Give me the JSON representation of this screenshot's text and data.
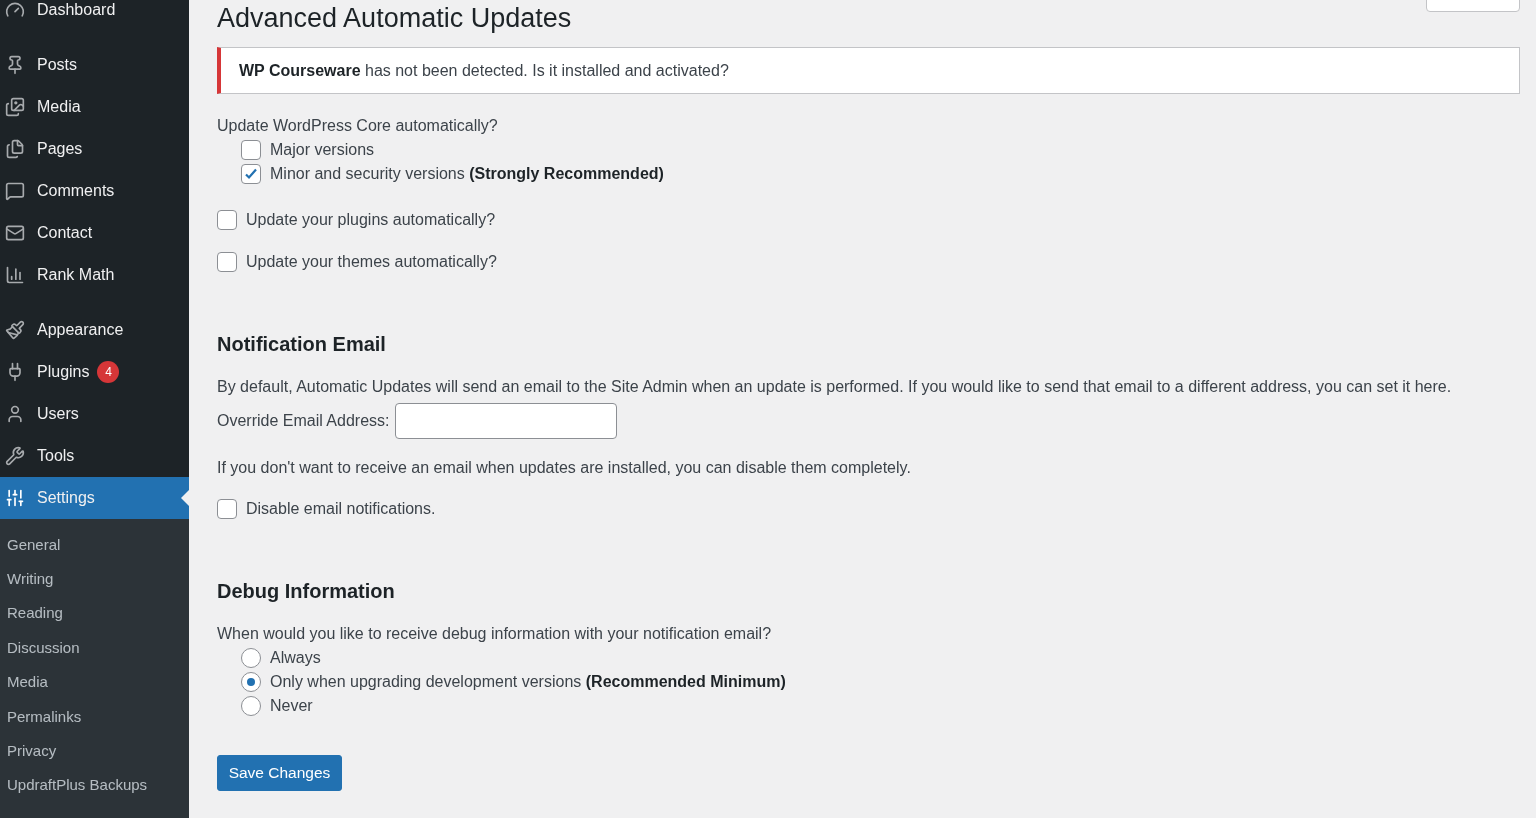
{
  "sidebar": {
    "menu_groups": [
      [
        {
          "label": "Dashboard",
          "selected": false
        }
      ],
      [
        {
          "label": "Posts",
          "selected": false
        },
        {
          "label": "Media",
          "selected": false
        },
        {
          "label": "Pages",
          "selected": false
        },
        {
          "label": "Comments",
          "selected": false
        },
        {
          "label": "Contact",
          "selected": false
        },
        {
          "label": "Rank Math",
          "selected": false
        }
      ],
      [
        {
          "label": "Appearance",
          "selected": false
        },
        {
          "label": "Plugins",
          "badge": "4",
          "selected": false
        },
        {
          "label": "Users",
          "selected": false
        },
        {
          "label": "Tools",
          "selected": false
        },
        {
          "label": "Settings",
          "selected": true
        }
      ]
    ],
    "submenu": [
      {
        "label": "General",
        "selected": false
      },
      {
        "label": "Writing",
        "selected": false
      },
      {
        "label": "Reading",
        "selected": false
      },
      {
        "label": "Discussion",
        "selected": false
      },
      {
        "label": "Media",
        "selected": false
      },
      {
        "label": "Permalinks",
        "selected": false
      },
      {
        "label": "Privacy",
        "selected": false
      },
      {
        "label": "UpdraftPlus Backups",
        "selected": false
      }
    ]
  },
  "page": {
    "title": "Advanced Automatic Updates",
    "notice": "**WP Courseware** has not been detected. Is it installed and activated?",
    "core": {
      "label": "Update WordPress Core automatically?",
      "options": [
        {
          "label": "Major versions",
          "checked": false
        },
        {
          "label": "Minor and security versions **(Strongly Recommended)**",
          "checked": true
        }
      ]
    },
    "checkboxes": [
      {
        "label": "Update your plugins automatically?",
        "checked": false
      },
      {
        "label": "Update your themes automatically?",
        "checked": false
      }
    ],
    "notification": {
      "heading": "Notification Email",
      "description": "By default, Automatic Updates will send an email to the Site Admin when an update is performed. If you would like to send that email to a different address, you can set it here.",
      "field_label": "Override Email Address:",
      "disable_note": "If you don't want to receive an email when updates are installed, you can disable them completely.",
      "disable": {
        "label": "Disable email notifications.",
        "checked": false
      }
    },
    "debug": {
      "heading": "Debug Information",
      "question": "When would you like to receive debug information with your notification email?",
      "options": [
        {
          "label": "Always",
          "selected": false
        },
        {
          "label": "Only when upgrading development versions **(Recommended Minimum)**",
          "selected": true
        },
        {
          "label": "Never",
          "selected": false
        }
      ]
    },
    "save_button": "Save Changes"
  }
}
